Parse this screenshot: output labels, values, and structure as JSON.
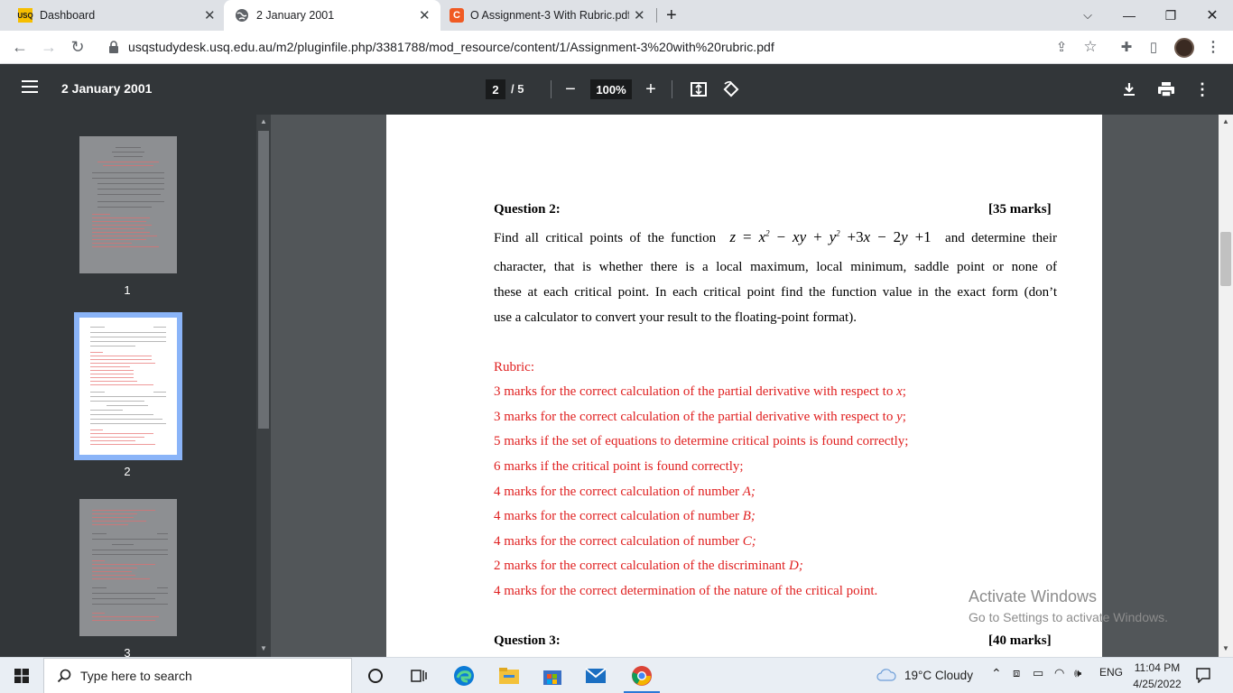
{
  "browser": {
    "tabs": [
      {
        "label": "Dashboard",
        "favicon": "usq-icon",
        "favicon_text": "USQ"
      },
      {
        "label": "2 January 2001",
        "favicon": "globe-icon",
        "active": true
      },
      {
        "label": "O Assignment-3 With Rubric.pdf",
        "favicon": "c-icon",
        "favicon_text": "C"
      }
    ],
    "new_tab": "+",
    "url": "usqstudydesk.usq.edu.au/m2/pluginfile.php/3381788/mod_resource/content/1/Assignment-3%20with%20rubric.pdf"
  },
  "pdf_toolbar": {
    "title": "2 January 2001",
    "current_page": "2",
    "page_total": "/ 5",
    "zoom": "100%"
  },
  "sidebar": {
    "thumbnails": [
      {
        "label": "1"
      },
      {
        "label": "2",
        "selected": true
      },
      {
        "label": "3"
      }
    ]
  },
  "document": {
    "question2": {
      "title": "Question 2:",
      "marks": "[35 marks]",
      "intro_before": "Find all critical points of the function",
      "intro_after": "and determine their",
      "line2": "character, that is whether there is a local maximum, local minimum, saddle point or none of",
      "line3": "these at each critical point. In each critical point find the function value in the exact form (don’t",
      "line4": "use a calculator to convert your result to the floating-point format)."
    },
    "rubric_heading": "Rubric:",
    "rubric": [
      {
        "text": "3 marks for the correct calculation of the partial derivative with respect to ",
        "var": "x",
        "end": ";"
      },
      {
        "text": "3 marks for the correct calculation of the partial derivative with respect to ",
        "var": "y",
        "end": ";"
      },
      {
        "text": "5 marks if the set of equations to determine critical points is found correctly;",
        "var": "",
        "end": ""
      },
      {
        "text": "6 marks if the critical point is found correctly;",
        "var": "",
        "end": ""
      },
      {
        "text": "4 marks for the correct calculation of number ",
        "var": "A",
        "end": ";"
      },
      {
        "text": "4 marks for the correct calculation of number ",
        "var": "B",
        "end": ";"
      },
      {
        "text": "4 marks for the correct calculation of number ",
        "var": "C",
        "end": ";"
      },
      {
        "text": "2 marks for the correct calculation of the discriminant ",
        "var": "D",
        "end": ";"
      },
      {
        "text": "4 marks for the correct determination of the nature of the critical point.",
        "var": "",
        "end": ""
      }
    ],
    "question3": {
      "title": "Question 3:",
      "marks": "[40 marks]"
    }
  },
  "watermark": {
    "line1": "Activate Windows",
    "line2": "Go to Settings to activate Windows."
  },
  "taskbar": {
    "search_placeholder": "Type here to search",
    "weather": "19°C  Cloudy",
    "language": "ENG",
    "time": "11:04 PM",
    "date": "4/25/2022"
  },
  "colors": {
    "rubric_red": "#e02020",
    "pdf_toolbar": "#323639",
    "selected_thumb": "#8ab4f8"
  }
}
